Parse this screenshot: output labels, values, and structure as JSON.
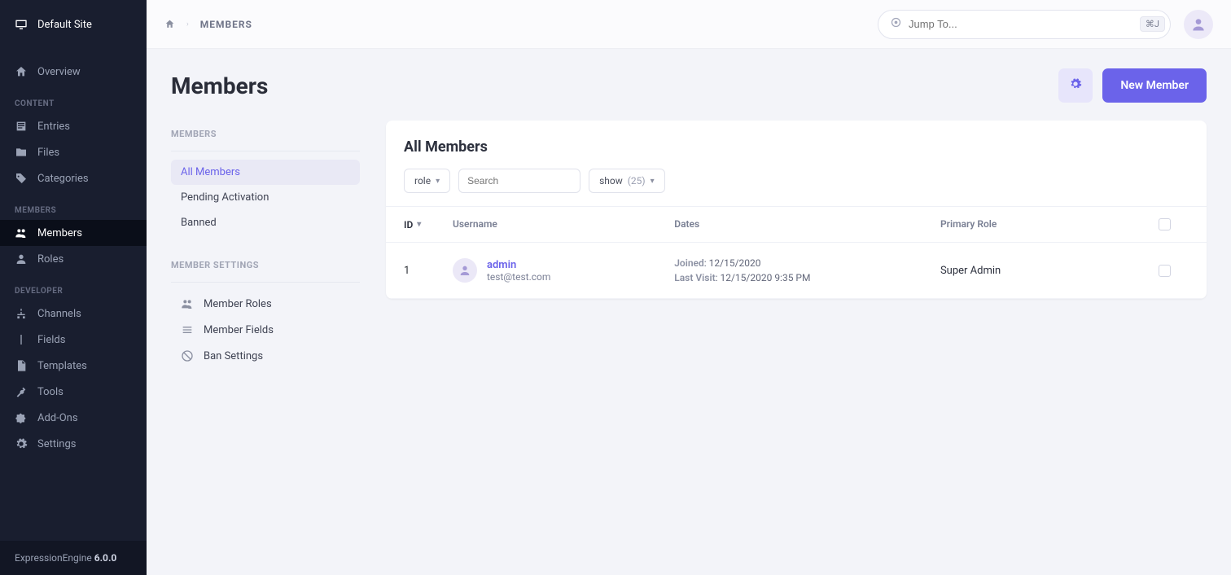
{
  "site_name": "Default Site",
  "sidebar": {
    "overview": "Overview",
    "sections": {
      "content": {
        "heading": "CONTENT",
        "entries": "Entries",
        "files": "Files",
        "categories": "Categories"
      },
      "members": {
        "heading": "MEMBERS",
        "members": "Members",
        "roles": "Roles"
      },
      "developer": {
        "heading": "DEVELOPER",
        "channels": "Channels",
        "fields": "Fields",
        "templates": "Templates",
        "tools": "Tools",
        "addons": "Add-Ons",
        "settings": "Settings"
      }
    }
  },
  "footer": {
    "product": "ExpressionEngine",
    "version": "6.0.0"
  },
  "topbar": {
    "breadcrumb": "MEMBERS",
    "jump_placeholder": "Jump To...",
    "jump_kbd": "⌘J"
  },
  "page": {
    "title": "Members",
    "new_button": "New Member"
  },
  "side_panel": {
    "members_heading": "MEMBERS",
    "all_members": "All Members",
    "pending": "Pending Activation",
    "banned": "Banned",
    "settings_heading": "MEMBER SETTINGS",
    "member_roles": "Member Roles",
    "member_fields": "Member Fields",
    "ban_settings": "Ban Settings"
  },
  "card": {
    "title": "All Members",
    "role_filter": "role",
    "search_placeholder": "Search",
    "show_label": "show",
    "show_count": "(25)"
  },
  "table": {
    "columns": {
      "id": "ID",
      "username": "Username",
      "dates": "Dates",
      "role": "Primary Role"
    },
    "rows": [
      {
        "id": "1",
        "username": "admin",
        "email": "test@test.com",
        "joined_label": "Joined",
        "joined_value": "12/15/2020",
        "last_label": "Last Visit",
        "last_value": "12/15/2020 9:35 PM",
        "role": "Super Admin"
      }
    ]
  }
}
